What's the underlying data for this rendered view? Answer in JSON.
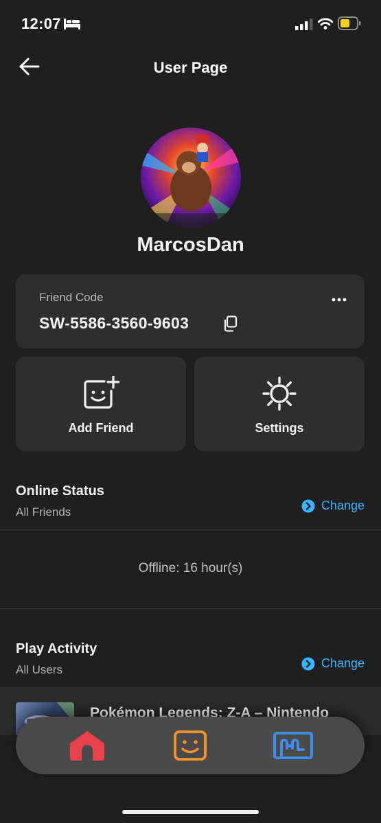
{
  "status_bar": {
    "time": "12:07",
    "icons": [
      "bed-icon",
      "signal-icon",
      "wifi-icon",
      "battery-icon"
    ],
    "battery_color": "#f5d020"
  },
  "header": {
    "title": "User Page",
    "back_icon": "arrow-left-icon"
  },
  "profile": {
    "username": "MarcosDan"
  },
  "friend_code_card": {
    "label": "Friend Code",
    "code": "SW-5586-3560-9603",
    "copy_icon": "copy-icon",
    "more_icon": "more-icon"
  },
  "actions": [
    {
      "label": "Add Friend",
      "icon": "add-friend-icon"
    },
    {
      "label": "Settings",
      "icon": "gear-icon"
    }
  ],
  "online_status": {
    "title": "Online Status",
    "subtitle": "All Friends",
    "change_label": "Change",
    "status_text": "Offline: 16 hour(s)"
  },
  "play_activity": {
    "title": "Play Activity",
    "subtitle": "All Users",
    "change_label": "Change",
    "items": [
      {
        "title": "Pokémon Legends: Z-A – Nintendo"
      }
    ]
  },
  "bottom_nav": {
    "items": [
      {
        "icon": "home-icon",
        "color": "#e8414e"
      },
      {
        "icon": "friends-icon",
        "color": "#f0912e"
      },
      {
        "icon": "gallery-icon",
        "color": "#3f8cea"
      }
    ]
  },
  "colors": {
    "background": "#1f1f1f",
    "card": "#2e2e2e",
    "accent_link": "#39b4ff"
  }
}
